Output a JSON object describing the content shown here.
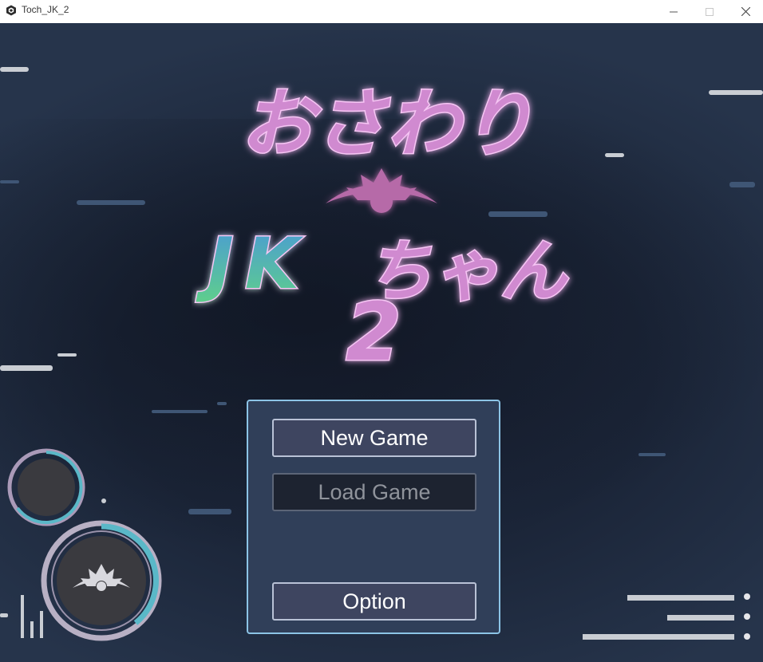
{
  "window": {
    "title": "Toch_JK_2",
    "controls": {
      "minimize": "minimize-icon",
      "maximize": "maximize-icon",
      "close": "close-icon"
    }
  },
  "logo": {
    "line1": "おさわり",
    "line2_latin": "JK",
    "line2_kana": "ちゃん",
    "line3": "2"
  },
  "menu": {
    "new_game": "New Game",
    "load_game": "Load Game",
    "option": "Option"
  },
  "colors": {
    "logo_pink": "#d08ad0",
    "logo_glow": "#f2a3ff",
    "logo_green": "#5fd08a",
    "logo_blue": "#4a9ad6",
    "panel_border": "#8cc4e6",
    "panel_bg": "#303f59",
    "knob_ring": "#5ab8c8"
  }
}
